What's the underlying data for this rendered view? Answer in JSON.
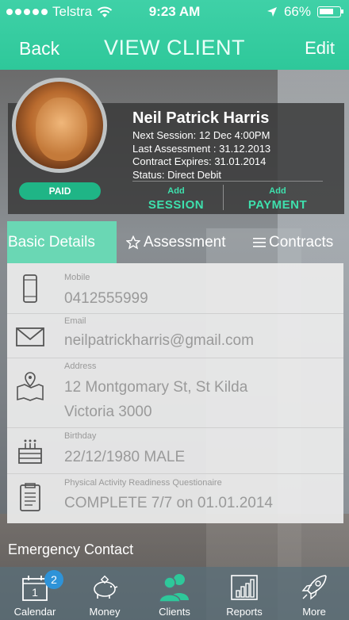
{
  "status_bar": {
    "carrier": "Telstra",
    "time": "9:23 AM",
    "battery": "66%"
  },
  "nav": {
    "back_label": "Back",
    "title": "VIEW CLIENT",
    "edit_label": "Edit"
  },
  "profile": {
    "name": "Neil Patrick Harris",
    "next_session": "Next Session: 12 Dec 4:00PM",
    "last_assessment": "Last Assessment : 31.12.2013",
    "contract_expires": "Contract Expires: 31.01.2014",
    "status": "Status: Direct Debit",
    "paid_badge": "PAID",
    "add_session": {
      "small": "Add",
      "big": "SESSION"
    },
    "add_payment": {
      "small": "Add",
      "big": "PAYMENT"
    }
  },
  "tabs": {
    "basic": "Basic Details",
    "assessment": "Assessment",
    "contracts": "Contracts"
  },
  "details": {
    "mobile": {
      "label": "Mobile",
      "value": "0412555999"
    },
    "email": {
      "label": "Email",
      "value": "neilpatrickharris@gmail.com"
    },
    "address": {
      "label": "Address",
      "line1": "12 Montgomary St, St Kilda",
      "line2": "Victoria 3000"
    },
    "birthday": {
      "label": "Birthday",
      "value": "22/12/1980 MALE"
    },
    "parq": {
      "label": "Physical Activity Readiness Questionaire",
      "value": "COMPLETE 7/7 on 01.01.2014"
    }
  },
  "emergency": {
    "title": "Emergency Contact"
  },
  "tabbar": {
    "calendar": "Calendar",
    "calendar_badge": "2",
    "calendar_day": "1",
    "money": "Money",
    "clients": "Clients",
    "reports": "Reports",
    "more": "More"
  },
  "colors": {
    "accent": "#2ec89a",
    "paid": "#1fb586",
    "badge": "#2e93d8"
  }
}
